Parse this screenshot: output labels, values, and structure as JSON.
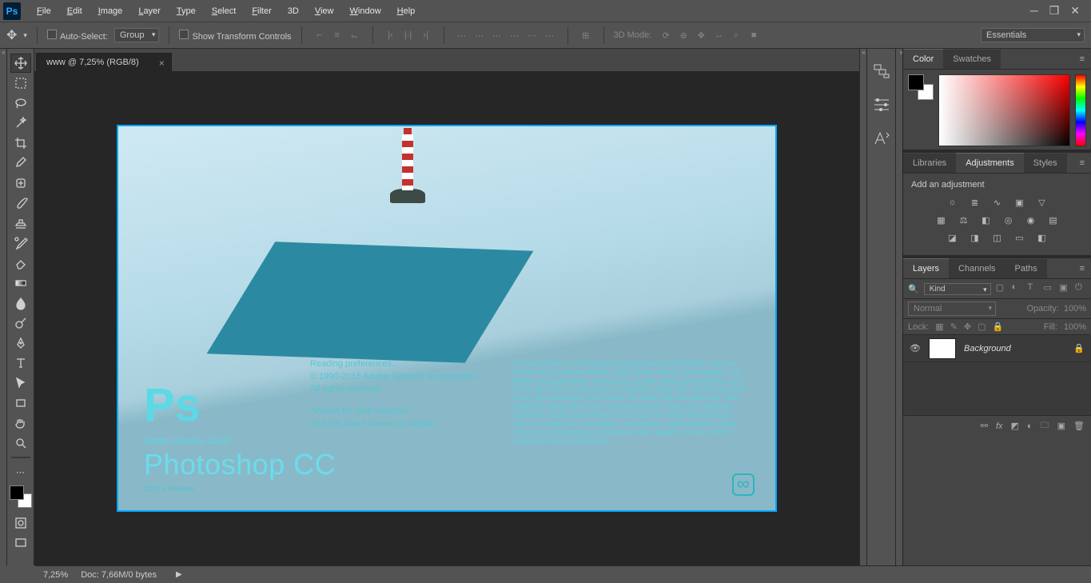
{
  "menubar": {
    "items": [
      "File",
      "Edit",
      "Image",
      "Layer",
      "Type",
      "Select",
      "Filter",
      "3D",
      "View",
      "Window",
      "Help"
    ]
  },
  "optionsbar": {
    "auto_select": "Auto-Select:",
    "group": "Group",
    "show_transform": "Show Transform Controls",
    "mode_3d": "3D Mode:",
    "workspace": "Essentials"
  },
  "document": {
    "tab_title": "www @ 7,25% (RGB/8)"
  },
  "splash": {
    "brand_line": "Adobe Creative Cloud",
    "product": "Photoshop CC",
    "release": "2015.5 Release",
    "loading": "Reading preferences...",
    "copyright": "© 1990-2016 Adobe Systems Incorporated.",
    "rights": "All rights reserved.",
    "artwork": "Artwork by Jack Usephot",
    "about": "See the About screen for details",
    "credits": "Thomas and John Knoll, Seetharaman Narayanan, Russell Williams, Judy Lee, David Hackel, Sohrab Amirghodsi, Jackie Lincoln-Owyang, Rachel Magnus, Tom McRae, Christopher Butler, Alan Erickson, Ivy Mak, Sarah Kong, Chris Cox, Jerry Harris, Mike Shaw, Thomas Ruark, Domnita Petri, David Mohr, Jonathan Lo, Betty Leong, John Worthington, Kevin Hopps, Tim Wright, Jeff Sass, Maria Yap, Yukie Takahashi, David Dobish, Jesper Storm Bache, Barry Young, John Townsend, Steven Eric Snyder, Judy Severance, Eric Floch, Allen Jeng, Meredith Payne Stotzner, Kiyotaka Taki, Tom Burbage, John Peterson, Kellisa Sandoval, Daniel Presedo, Irina Satanovskaya, Zorana Gee, Adam Jerugim, Tom Attix, John E. Hanson, B. Winston Hendrickson."
  },
  "panels": {
    "color": {
      "tab1": "Color",
      "tab2": "Swatches"
    },
    "adjustments": {
      "tab1": "Libraries",
      "tab2": "Adjustments",
      "tab3": "Styles",
      "title": "Add an adjustment"
    },
    "layers": {
      "tab1": "Layers",
      "tab2": "Channels",
      "tab3": "Paths",
      "filter_kind": "Kind",
      "blend": "Normal",
      "opacity_lbl": "Opacity:",
      "opacity_val": "100%",
      "lock_lbl": "Lock:",
      "fill_lbl": "Fill:",
      "fill_val": "100%",
      "layer0": {
        "name": "Background"
      }
    }
  },
  "status": {
    "zoom": "7,25%",
    "doc": "Doc: 7,66M/0 bytes"
  }
}
